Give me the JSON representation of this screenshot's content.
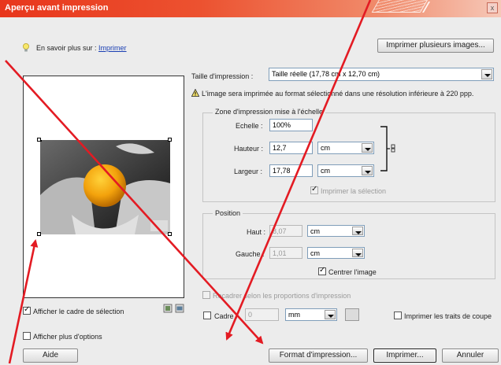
{
  "window": {
    "title": "Aperçu avant impression",
    "close_glyph": "x"
  },
  "learn_more": {
    "prefix": "En savoir plus sur :",
    "link": "Imprimer"
  },
  "buttons": {
    "print_multiple": "Imprimer plusieurs images...",
    "help": "Aide",
    "page_setup": "Format d'impression...",
    "print": "Imprimer...",
    "cancel": "Annuler"
  },
  "print_size": {
    "label": "Taille d'impression :",
    "value": "Taille réelle (17,78 cm x 12,70 cm)",
    "warning": "L'image sera imprimée au format sélectionné dans une résolution inférieure à 220 ppp."
  },
  "scaled_area": {
    "title": "Zone d'impression mise à l'échelle",
    "scale_label": "Echelle :",
    "scale_value": "100%",
    "height_label": "Hauteur :",
    "height_value": "12,7",
    "height_unit": "cm",
    "width_label": "Largeur :",
    "width_value": "17,78",
    "width_unit": "cm",
    "print_selection": "Imprimer la sélection"
  },
  "position": {
    "title": "Position",
    "top_label": "Haut :",
    "top_value": "8,07",
    "top_unit": "cm",
    "left_label": "Gauche :",
    "left_value": "1,01",
    "left_unit": "cm",
    "center_image": "Centrer l'image"
  },
  "options": {
    "crop_to_ratio": "Recadrer selon les proportions d'impression",
    "border_label": "Cadre :",
    "border_value": "0",
    "border_unit": "mm",
    "crop_marks": "Imprimer les traits de coupe",
    "show_bounding_box": "Afficher le cadre de sélection",
    "show_more_options": "Afficher plus d'options"
  }
}
